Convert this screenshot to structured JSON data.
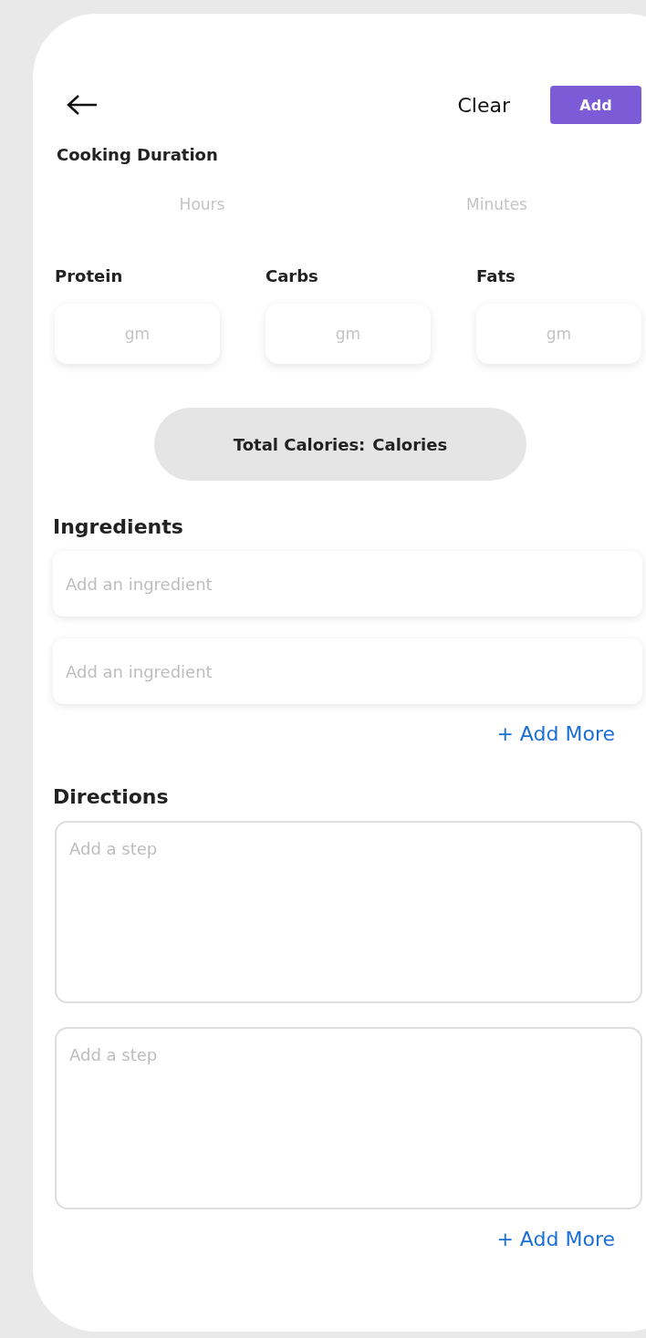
{
  "header": {
    "clear_label": "Clear",
    "add_label": "Add"
  },
  "cooking_duration": {
    "title": "Cooking Duration",
    "fields": [
      {
        "placeholder": "Hours"
      },
      {
        "placeholder": "Minutes"
      }
    ]
  },
  "macros": [
    {
      "label": "Protein",
      "placeholder": "gm"
    },
    {
      "label": "Carbs",
      "placeholder": "gm"
    },
    {
      "label": "Fats",
      "placeholder": "gm"
    }
  ],
  "total_calories": {
    "label": "Total Calories:",
    "value": "Calories"
  },
  "ingredients": {
    "title": "Ingredients",
    "fields": [
      {
        "placeholder": "Add an ingredient"
      },
      {
        "placeholder": "Add an ingredient"
      }
    ],
    "add_more": "+ Add More"
  },
  "directions": {
    "title": "Directions",
    "fields": [
      {
        "placeholder": "Add a step"
      },
      {
        "placeholder": "Add a step"
      }
    ],
    "add_more": "+ Add More"
  }
}
